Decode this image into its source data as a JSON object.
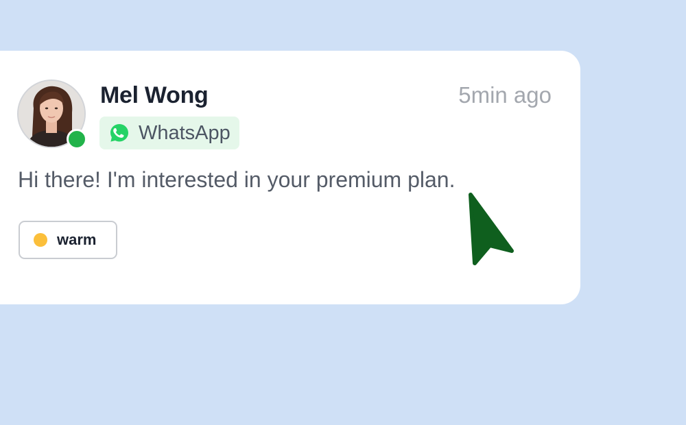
{
  "contact": {
    "name": "Mel Wong",
    "time_ago": "5min ago",
    "status": "online",
    "avatar_icon": "person-photo"
  },
  "channel": {
    "label": "WhatsApp",
    "icon": "whatsapp-icon",
    "color": "#25d366"
  },
  "message": {
    "text": "Hi there! I'm interested in your premium plan."
  },
  "tag": {
    "label": "warm",
    "color": "#fbbf3b"
  },
  "colors": {
    "background": "#cfe0f6",
    "card": "#ffffff",
    "online": "#22b34a",
    "cursor": "#0f5f1e"
  }
}
